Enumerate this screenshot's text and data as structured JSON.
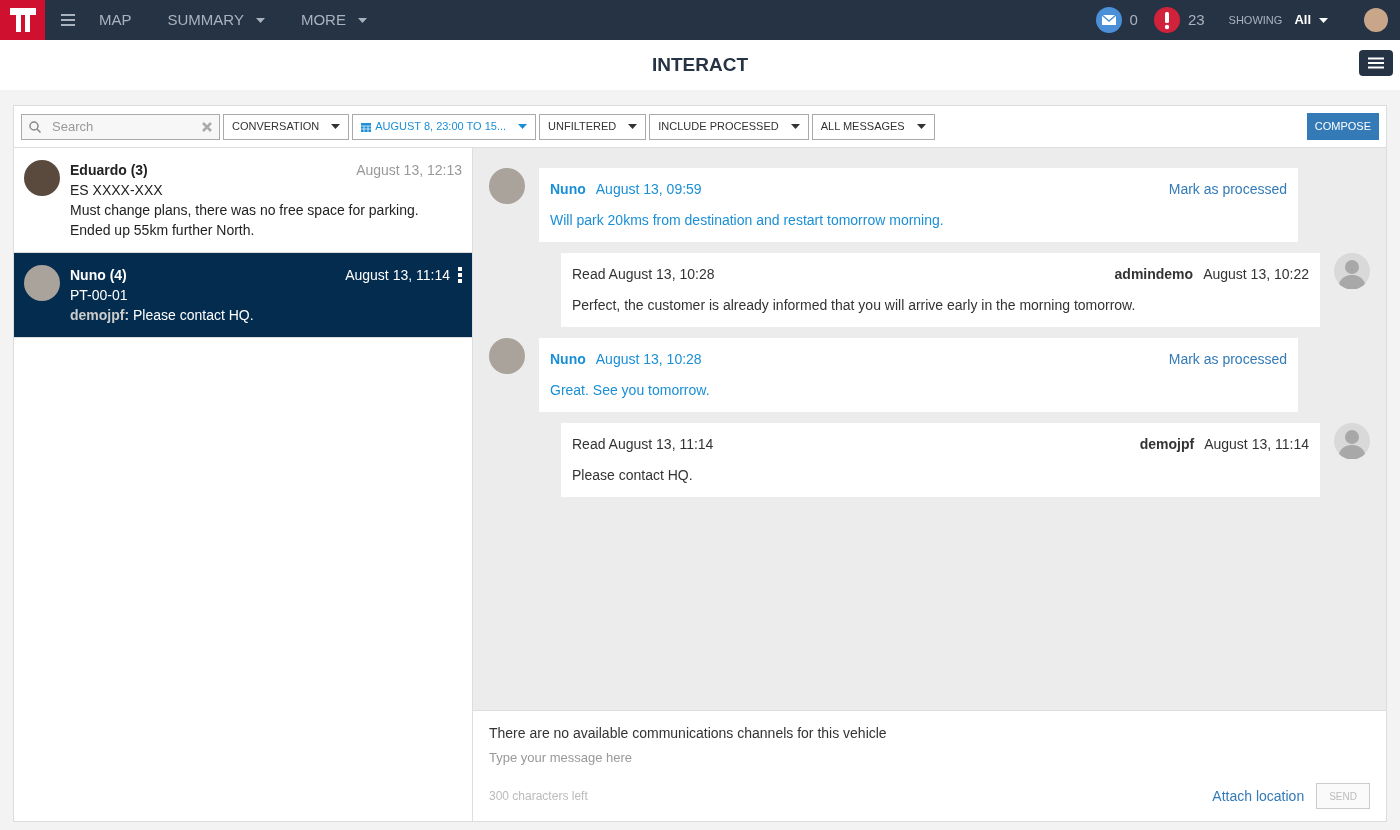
{
  "nav": {
    "items": [
      {
        "label": "MAP",
        "dropdown": false
      },
      {
        "label": "SUMMARY",
        "dropdown": true
      },
      {
        "label": "MORE",
        "dropdown": true
      }
    ],
    "messages_count": "0",
    "alerts_count": "23",
    "showing_label": "SHOWING",
    "showing_value": "All"
  },
  "page_title": "INTERACT",
  "toolbar": {
    "search_placeholder": "Search",
    "filters": [
      {
        "label": "CONVERSATION",
        "active": false
      },
      {
        "label": "AUGUST 8, 23:00 TO 15...",
        "active": true
      },
      {
        "label": "UNFILTERED",
        "active": false
      },
      {
        "label": "INCLUDE PROCESSED",
        "active": false
      },
      {
        "label": "ALL MESSAGES",
        "active": false
      }
    ],
    "compose": "COMPOSE"
  },
  "conversations": [
    {
      "name": "Eduardo (3)",
      "time": "August 13, 12:13",
      "plate": "ES XXXX-XXX",
      "preview": "Must change plans, there was no free space for parking. Ended up 55km further North.",
      "selected": false
    },
    {
      "name": "Nuno (4)",
      "time": "August 13, 11:14",
      "plate": "PT-00-01",
      "sender": "demojpf:",
      "preview": "Please contact HQ.",
      "selected": true
    }
  ],
  "messages": [
    {
      "kind": "in",
      "author": "Nuno",
      "time": "August 13, 09:59",
      "action": "Mark as processed",
      "text": "Will park 20kms from destination and restart tomorrow morning."
    },
    {
      "kind": "out",
      "read": "Read August 13, 10:28",
      "author": "admindemo",
      "time": "August 13, 10:22",
      "text": "Perfect, the customer is already informed that you will arrive early in the morning tomorrow."
    },
    {
      "kind": "in",
      "author": "Nuno",
      "time": "August 13, 10:28",
      "action": "Mark as processed",
      "text": "Great. See you tomorrow."
    },
    {
      "kind": "out",
      "read": "Read August 13, 11:14",
      "author": "demojpf",
      "time": "August 13, 11:14",
      "text": "Please contact HQ."
    }
  ],
  "composer": {
    "notice": "There are no available communications channels for this vehicle",
    "placeholder": "Type your message here",
    "chars_left": "300 characters left",
    "attach": "Attach location",
    "send": "SEND",
    "send_disabled": true
  }
}
